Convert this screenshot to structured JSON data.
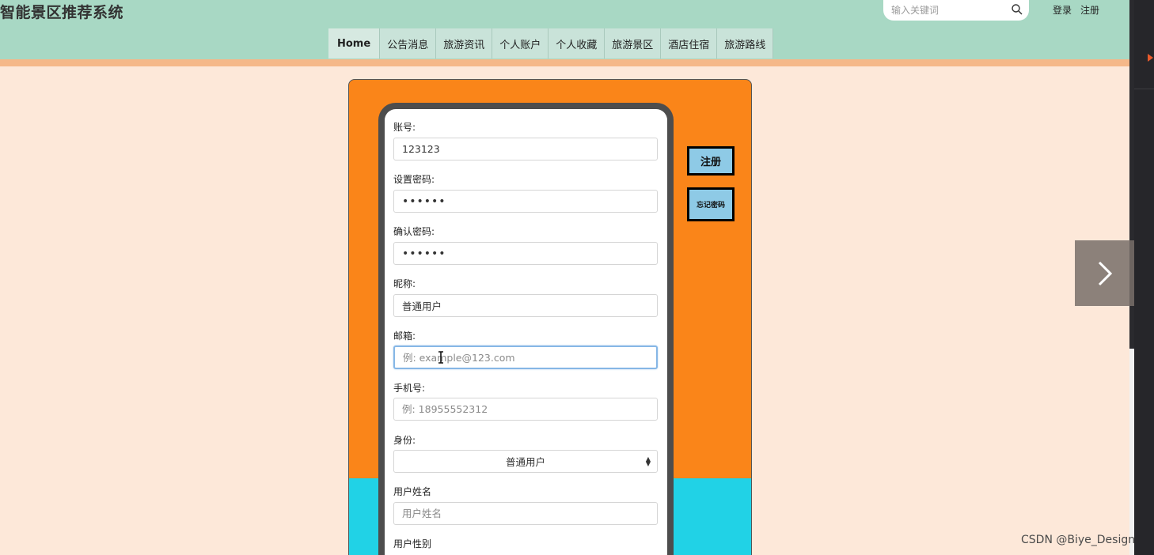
{
  "header": {
    "site_title": "智能景区推荐系统",
    "search_placeholder": "输入关键词",
    "login": "登录",
    "register": "注册"
  },
  "nav": {
    "items": [
      "Home",
      "公告消息",
      "旅游资讯",
      "个人账户",
      "个人收藏",
      "旅游景区",
      "酒店住宿",
      "旅游路线"
    ],
    "active": "Home"
  },
  "form": {
    "account_label": "账号:",
    "account_value": "123123",
    "password_label": "设置密码:",
    "password_value": "••••••",
    "confirm_label": "确认密码:",
    "confirm_value": "••••••",
    "nickname_label": "昵称:",
    "nickname_value": "普通用户",
    "email_label": "邮箱:",
    "email_placeholder": "例: example@123.com",
    "phone_label": "手机号:",
    "phone_placeholder": "例: 18955552312",
    "role_label": "身份:",
    "role_value": "普通用户",
    "realname_label": "用户姓名",
    "realname_placeholder": "用户姓名",
    "gender_label": "用户性别"
  },
  "buttons": {
    "register": "注册",
    "forgot": "忘记密码"
  },
  "watermark": "CSDN @Biye_Design",
  "colors": {
    "header_bg": "#a8d8c4",
    "page_bg": "#fde8d9",
    "panel_orange": "#fa8519",
    "panel_cyan": "#21d2e6",
    "button_bg": "#8ecae6"
  }
}
